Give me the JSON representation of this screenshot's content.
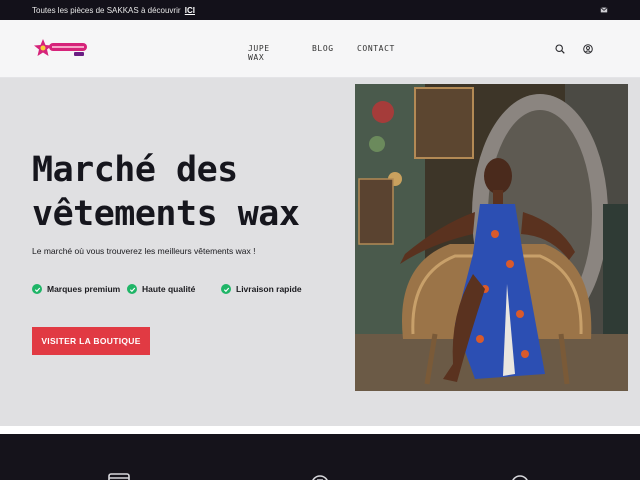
{
  "topbar": {
    "message": "Toutes les pièces de SAKKAS à découvrir",
    "link_label": "ICI",
    "mail_icon": "mail-icon"
  },
  "header": {
    "nav": [
      "JUPE WAX",
      "BLOG",
      "CONTACT"
    ],
    "icons": [
      "search-icon",
      "user-icon"
    ]
  },
  "hero": {
    "title_line1": "Marché des",
    "title_line2": "vêtements wax",
    "subtitle": "Le marché où vous trouverez les meilleurs vêtements wax !",
    "features": [
      "Marques premium",
      "Haute qualité",
      "Livraison rapide"
    ],
    "cta_label": "VISITER LA BOUTIQUE"
  },
  "colors": {
    "accent": "#e13a43",
    "check": "#1fb567",
    "topbar_bg": "#13111a",
    "hero_bg": "#e0e0e2",
    "footer_bg": "#15131b"
  },
  "footer": {
    "icons": [
      "store-icon",
      "return-icon",
      "support-icon"
    ]
  }
}
